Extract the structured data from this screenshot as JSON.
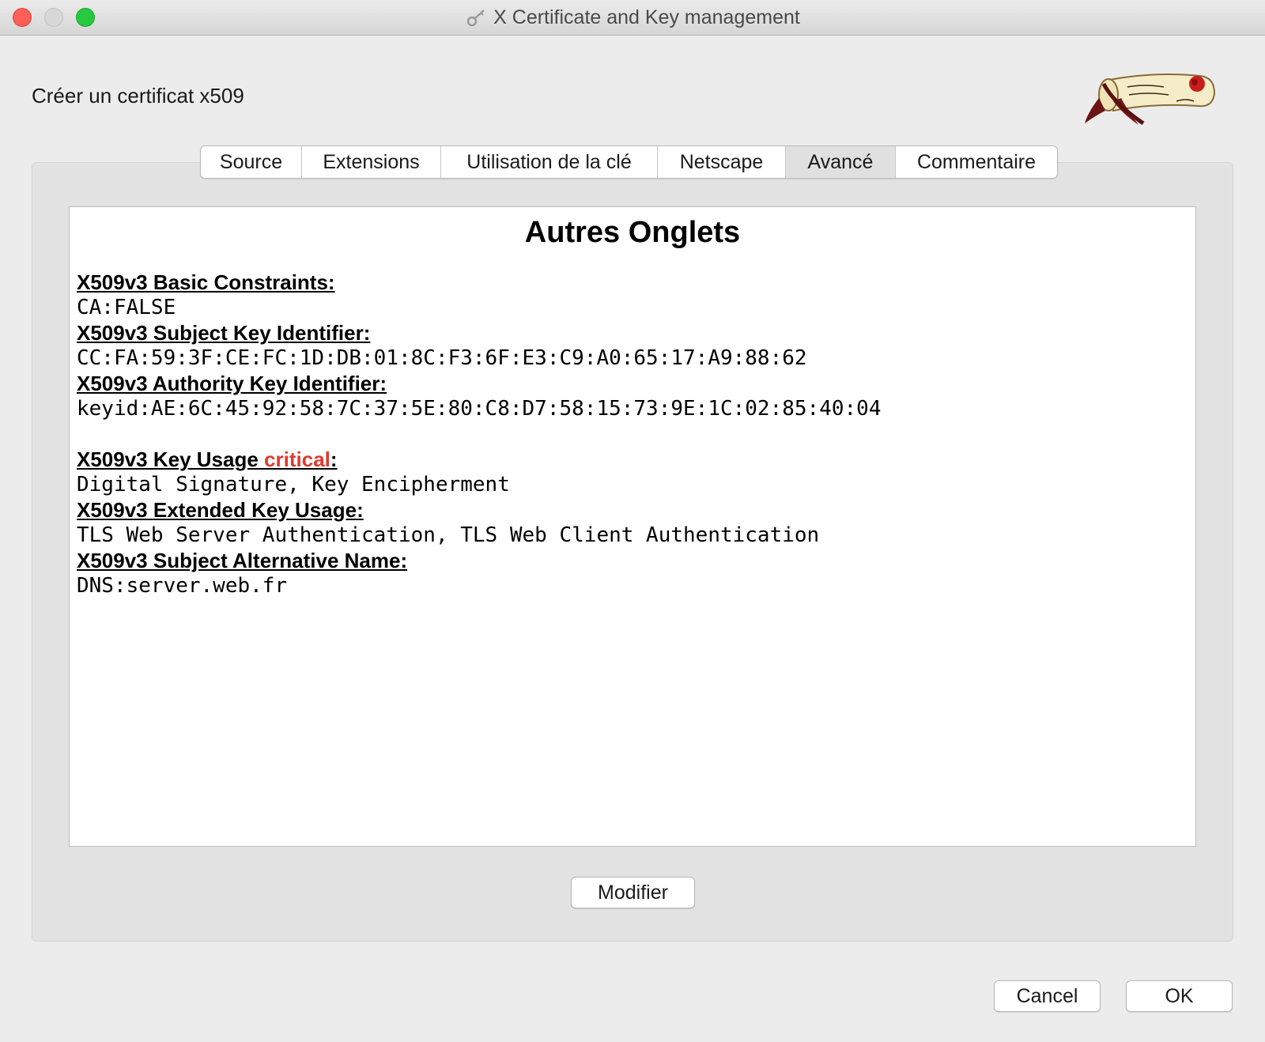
{
  "window": {
    "title": "X Certificate and Key management"
  },
  "dialog": {
    "heading": "Créer un certificat x509"
  },
  "tabs": [
    {
      "label": "Source",
      "active": false
    },
    {
      "label": "Extensions",
      "active": false
    },
    {
      "label": "Utilisation de la clé",
      "active": false
    },
    {
      "label": "Netscape",
      "active": false
    },
    {
      "label": "Avancé",
      "active": true
    },
    {
      "label": "Commentaire",
      "active": false
    }
  ],
  "advanced": {
    "title": "Autres Onglets",
    "extensions": [
      {
        "name": "X509v3 Basic Constraints:",
        "value": "CA:FALSE"
      },
      {
        "name": "X509v3 Subject Key Identifier:",
        "value": "CC:FA:59:3F:CE:FC:1D:DB:01:8C:F3:6F:E3:C9:A0:65:17:A9:88:62"
      },
      {
        "name": "X509v3 Authority Key Identifier:",
        "value": "keyid:AE:6C:45:92:58:7C:37:5E:80:C8:D7:58:15:73:9E:1C:02:85:40:04"
      },
      {
        "name_prefix": "X509v3 Key Usage ",
        "critical": "critical",
        "name_suffix": ":",
        "value": "Digital Signature, Key Encipherment"
      },
      {
        "name": "X509v3 Extended Key Usage:",
        "value": "TLS Web Server Authentication, TLS Web Client Authentication"
      },
      {
        "name": "X509v3 Subject Alternative Name:",
        "value": "DNS:server.web.fr"
      }
    ]
  },
  "buttons": {
    "modify": "Modifier",
    "cancel": "Cancel",
    "ok": "OK"
  },
  "colors": {
    "critical": "#e03a2e",
    "window_bg": "#ececec",
    "panel_bg": "#e2e2e2",
    "close": "#fe5f57",
    "maximize": "#28c840"
  },
  "icons": {
    "title_icon": "certificate-key-icon",
    "logo": "scroll-rose-logo"
  }
}
